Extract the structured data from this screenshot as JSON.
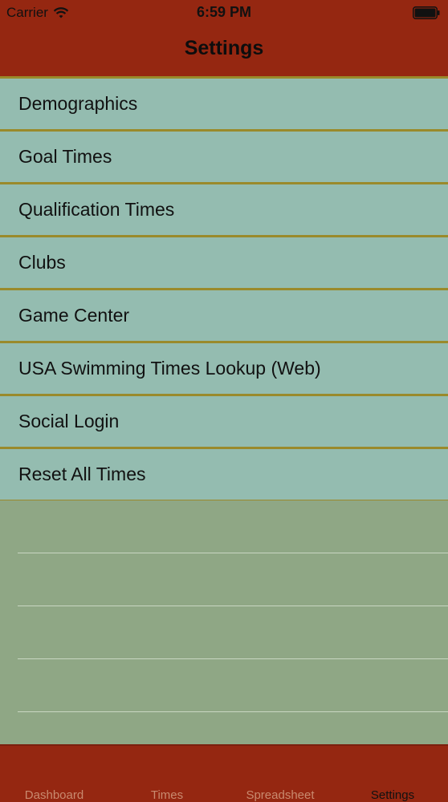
{
  "status_bar": {
    "carrier": "Carrier",
    "time": "6:59 PM",
    "wifi_icon": "wifi-icon",
    "battery_icon": "battery-icon"
  },
  "nav": {
    "title": "Settings"
  },
  "settings": {
    "items": [
      {
        "label": "Demographics"
      },
      {
        "label": "Goal Times"
      },
      {
        "label": "Qualification Times"
      },
      {
        "label": "Clubs"
      },
      {
        "label": "Game Center"
      },
      {
        "label": "USA Swimming Times Lookup (Web)"
      },
      {
        "label": "Social Login"
      },
      {
        "label": "Reset All Times"
      }
    ]
  },
  "tabbar": {
    "tabs": [
      {
        "label": "Dashboard",
        "active": false
      },
      {
        "label": "Times",
        "active": false
      },
      {
        "label": "Spreadsheet",
        "active": false
      },
      {
        "label": "Settings",
        "active": true
      }
    ]
  },
  "colors": {
    "bar": "#952711",
    "row": "#94bcb0",
    "separator": "#9a8a2b",
    "background": "#8fa785",
    "tab_inactive": "#c98a6f",
    "tab_active": "#111111"
  }
}
